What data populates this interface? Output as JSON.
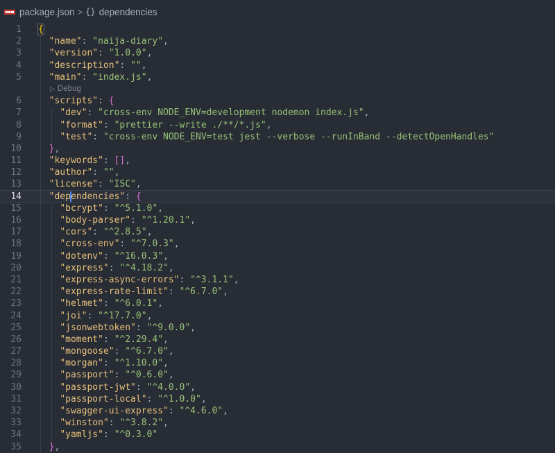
{
  "breadcrumb": {
    "file": "package.json",
    "separator": ">",
    "symbol_icon": "{}",
    "symbol": "dependencies"
  },
  "codelens": {
    "label": "Debug",
    "icon": "play-icon"
  },
  "editor": {
    "current_line": 14,
    "lines": [
      {
        "n": "1"
      },
      {
        "n": "2"
      },
      {
        "n": "3"
      },
      {
        "n": "4"
      },
      {
        "n": "5"
      },
      {
        "n": "6"
      },
      {
        "n": "7"
      },
      {
        "n": "8"
      },
      {
        "n": "9"
      },
      {
        "n": "10"
      },
      {
        "n": "11"
      },
      {
        "n": "12"
      },
      {
        "n": "13"
      },
      {
        "n": "14"
      },
      {
        "n": "15"
      },
      {
        "n": "16"
      },
      {
        "n": "17"
      },
      {
        "n": "18"
      },
      {
        "n": "19"
      },
      {
        "n": "20"
      },
      {
        "n": "21"
      },
      {
        "n": "22"
      },
      {
        "n": "23"
      },
      {
        "n": "24"
      },
      {
        "n": "25"
      },
      {
        "n": "26"
      },
      {
        "n": "27"
      },
      {
        "n": "28"
      },
      {
        "n": "29"
      },
      {
        "n": "30"
      },
      {
        "n": "31"
      },
      {
        "n": "32"
      },
      {
        "n": "33"
      },
      {
        "n": "34"
      },
      {
        "n": "35"
      }
    ],
    "root": {
      "name_key": "\"name\"",
      "name_val": "\"naija-diary\"",
      "version_key": "\"version\"",
      "version_val": "\"1.0.0\"",
      "description_key": "\"description\"",
      "description_val": "\"\"",
      "main_key": "\"main\"",
      "main_val": "\"index.js\"",
      "scripts_key": "\"scripts\"",
      "keywords_key": "\"keywords\"",
      "author_key": "\"author\"",
      "author_val": "\"\"",
      "license_key": "\"license\"",
      "license_val": "\"ISC\"",
      "dependencies_key_a": "\"dep",
      "dependencies_key_b": "endencies\""
    },
    "scripts": [
      {
        "key": "\"dev\"",
        "val": "\"cross-env NODE_ENV=development nodemon index.js\"",
        "end": ","
      },
      {
        "key": "\"format\"",
        "val": "\"prettier --write ./**/*.js\"",
        "end": ","
      },
      {
        "key": "\"test\"",
        "val": "\"cross-env NODE_ENV=test jest --verbose --runInBand --detectOpenHandles\"",
        "end": ""
      }
    ],
    "dependencies": [
      {
        "key": "\"bcrypt\"",
        "val": "\"^5.1.0\"",
        "end": ","
      },
      {
        "key": "\"body-parser\"",
        "val": "\"^1.20.1\"",
        "end": ","
      },
      {
        "key": "\"cors\"",
        "val": "\"^2.8.5\"",
        "end": ","
      },
      {
        "key": "\"cross-env\"",
        "val": "\"^7.0.3\"",
        "end": ","
      },
      {
        "key": "\"dotenv\"",
        "val": "\"^16.0.3\"",
        "end": ","
      },
      {
        "key": "\"express\"",
        "val": "\"^4.18.2\"",
        "end": ","
      },
      {
        "key": "\"express-async-errors\"",
        "val": "\"^3.1.1\"",
        "end": ","
      },
      {
        "key": "\"express-rate-limit\"",
        "val": "\"^6.7.0\"",
        "end": ","
      },
      {
        "key": "\"helmet\"",
        "val": "\"^6.0.1\"",
        "end": ","
      },
      {
        "key": "\"joi\"",
        "val": "\"^17.7.0\"",
        "end": ","
      },
      {
        "key": "\"jsonwebtoken\"",
        "val": "\"^9.0.0\"",
        "end": ","
      },
      {
        "key": "\"moment\"",
        "val": "\"^2.29.4\"",
        "end": ","
      },
      {
        "key": "\"mongoose\"",
        "val": "\"^6.7.0\"",
        "end": ","
      },
      {
        "key": "\"morgan\"",
        "val": "\"^1.10.0\"",
        "end": ","
      },
      {
        "key": "\"passport\"",
        "val": "\"^0.6.0\"",
        "end": ","
      },
      {
        "key": "\"passport-jwt\"",
        "val": "\"^4.0.0\"",
        "end": ","
      },
      {
        "key": "\"passport-local\"",
        "val": "\"^1.0.0\"",
        "end": ","
      },
      {
        "key": "\"swagger-ui-express\"",
        "val": "\"^4.6.0\"",
        "end": ","
      },
      {
        "key": "\"winston\"",
        "val": "\"^3.8.2\"",
        "end": ","
      },
      {
        "key": "\"yamljs\"",
        "val": "\"^0.3.0\"",
        "end": ""
      }
    ]
  },
  "colors": {
    "background": "#282c34",
    "key": "#e5c07b",
    "string": "#98c379",
    "bracket_level1": "#ffd700",
    "bracket_level2": "#da70d6",
    "line_number": "#6d737f",
    "cursor": "#528bff"
  }
}
